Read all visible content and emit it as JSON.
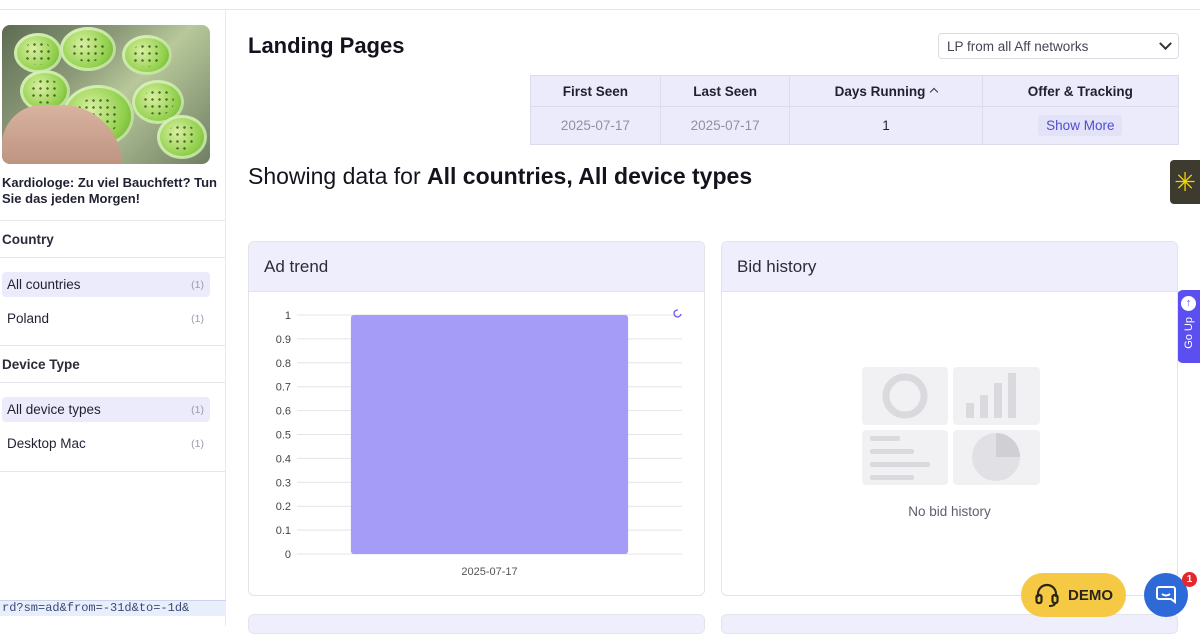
{
  "ad": {
    "caption": "Kardiologe: Zu viel Bauchfett? Tun Sie das jeden Morgen!"
  },
  "filters": {
    "country_title": "Country",
    "countries": [
      {
        "label": "All countries",
        "count": "(1)",
        "active": true
      },
      {
        "label": "Poland",
        "count": "(1)",
        "active": false
      }
    ],
    "device_title": "Device Type",
    "devices": [
      {
        "label": "All device types",
        "count": "(1)",
        "active": true
      },
      {
        "label": "Desktop Mac",
        "count": "(1)",
        "active": false
      }
    ]
  },
  "status_url": "rd?sm=ad&from=-31d&to=-1d&",
  "header": {
    "title": "Landing Pages",
    "network_select": "LP from all Aff networks"
  },
  "lp_table": {
    "columns": [
      "First Seen",
      "Last Seen",
      "Days Running",
      "Offer & Tracking"
    ],
    "row": {
      "first_seen": "2025-07-17",
      "last_seen": "2025-07-17",
      "days_running": "1",
      "action": "Show More"
    }
  },
  "showing": {
    "prefix": "Showing data for ",
    "scope": "All countries, All device types"
  },
  "side_tabs": {
    "go_up": "Go Up"
  },
  "ad_trend": {
    "title": "Ad trend"
  },
  "bid_history": {
    "title": "Bid history",
    "empty_text": "No bid history"
  },
  "buttons": {
    "demo": "DEMO",
    "chat_badge": "1"
  },
  "colors": {
    "accent": "#a59cf7",
    "header_bg": "#efeefc",
    "demo": "#f6c945",
    "chat": "#2d6ad8"
  },
  "chart_data": {
    "type": "bar",
    "categories": [
      "2025-07-17"
    ],
    "values": [
      1
    ],
    "ylim": [
      0,
      1
    ],
    "yticks": [
      "0",
      "0.1",
      "0.2",
      "0.3",
      "0.4",
      "0.5",
      "0.6",
      "0.7",
      "0.8",
      "0.9",
      "1"
    ],
    "grid": true,
    "color": "#a59cf7"
  }
}
